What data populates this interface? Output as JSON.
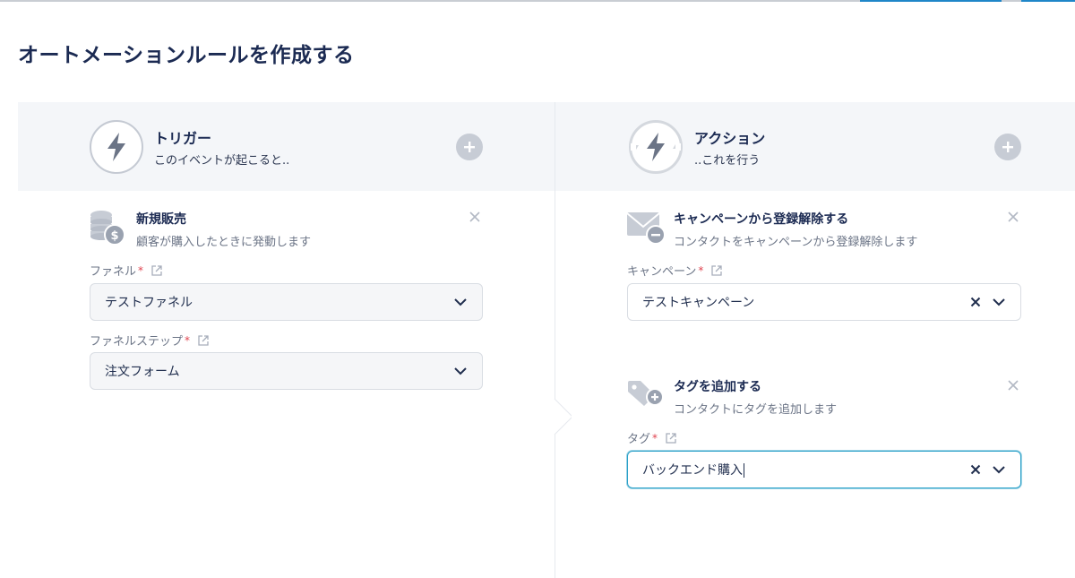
{
  "page": {
    "title": "オートメーションルールを作成する"
  },
  "trigger_header": {
    "title": "トリガー",
    "subtitle": "このイベントが起こると.."
  },
  "action_header": {
    "title": "アクション",
    "subtitle": "..これを行う"
  },
  "trigger": {
    "title": "新規販売",
    "description": "顧客が購入したときに発動します",
    "fields": [
      {
        "label": "ファネル",
        "value": "テストファネル"
      },
      {
        "label": "ファネルステップ",
        "value": "注文フォーム"
      }
    ]
  },
  "actions": [
    {
      "title": "キャンペーンから登録解除する",
      "description": "コンタクトをキャンペーンから登録解除します",
      "field": {
        "label": "キャンペーン",
        "value": "テストキャンペーン"
      }
    },
    {
      "title": "タグを追加する",
      "description": "コンタクトにタグを追加します",
      "field": {
        "label": "タグ",
        "value": "バックエンド購入"
      }
    }
  ],
  "colors": {
    "accent": "#1f86c8",
    "focus": "#2aa0c8",
    "required": "#e0434f",
    "title": "#1b2a52"
  }
}
